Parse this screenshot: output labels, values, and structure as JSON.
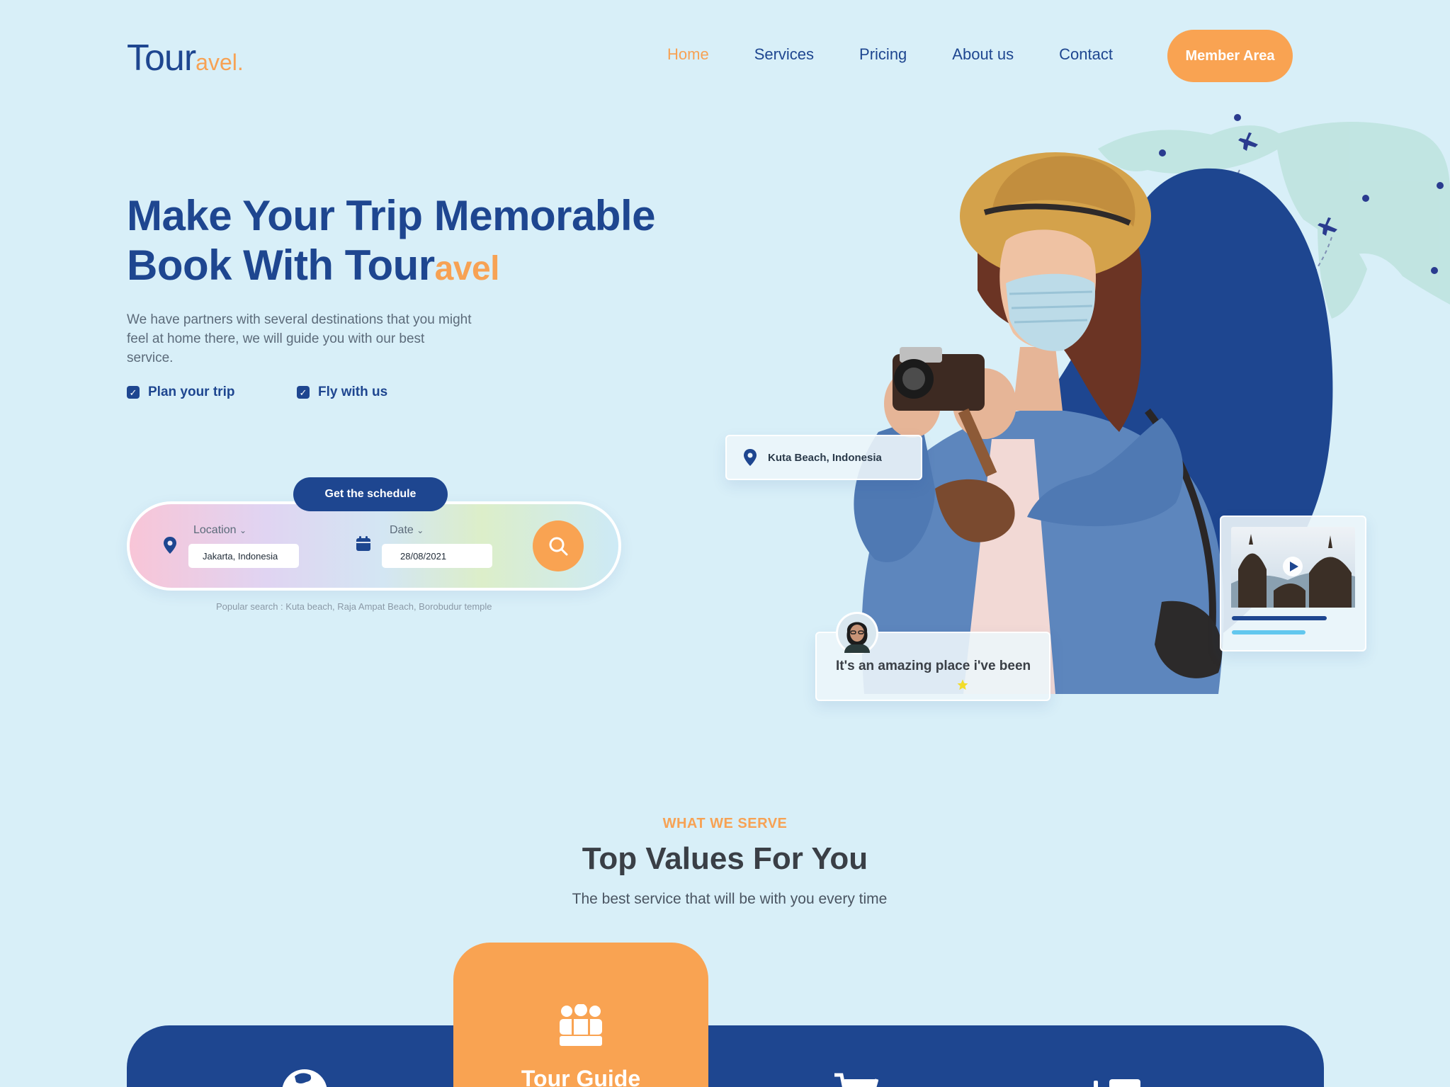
{
  "brand": {
    "logo_main": "Tour",
    "logo_accent": "avel."
  },
  "nav": {
    "items": [
      "Home",
      "Services",
      "Pricing",
      "About us",
      "Contact"
    ],
    "active": "Home",
    "cta": "Member Area"
  },
  "hero": {
    "title_line1": "Make Your Trip Memorable",
    "title_line2_main": "Book With Tour",
    "title_line2_accent": "avel",
    "subtitle": "We have partners with several destinations that you might feel at home there, we will guide you with our best service.",
    "checks": [
      "Plan your trip",
      "Fly with us"
    ]
  },
  "search": {
    "schedule_button": "Get the schedule",
    "location_label": "Location",
    "location_value": "Jakarta, Indonesia",
    "date_label": "Date",
    "date_value": "28/08/2021",
    "popular": "Popular search : Kuta beach, Raja Ampat Beach, Borobudur temple"
  },
  "hero_cards": {
    "location": "Kuta Beach, Indonesia",
    "review": "It's an amazing place i've been"
  },
  "values": {
    "eyebrow": "WHAT WE SERVE",
    "title": "Top Values For You",
    "subtitle": "The best service that will be with you every time",
    "active_card": "Tour Guide"
  },
  "colors": {
    "primary": "#1e4690",
    "accent": "#f9a352",
    "background": "#d8eff8"
  }
}
